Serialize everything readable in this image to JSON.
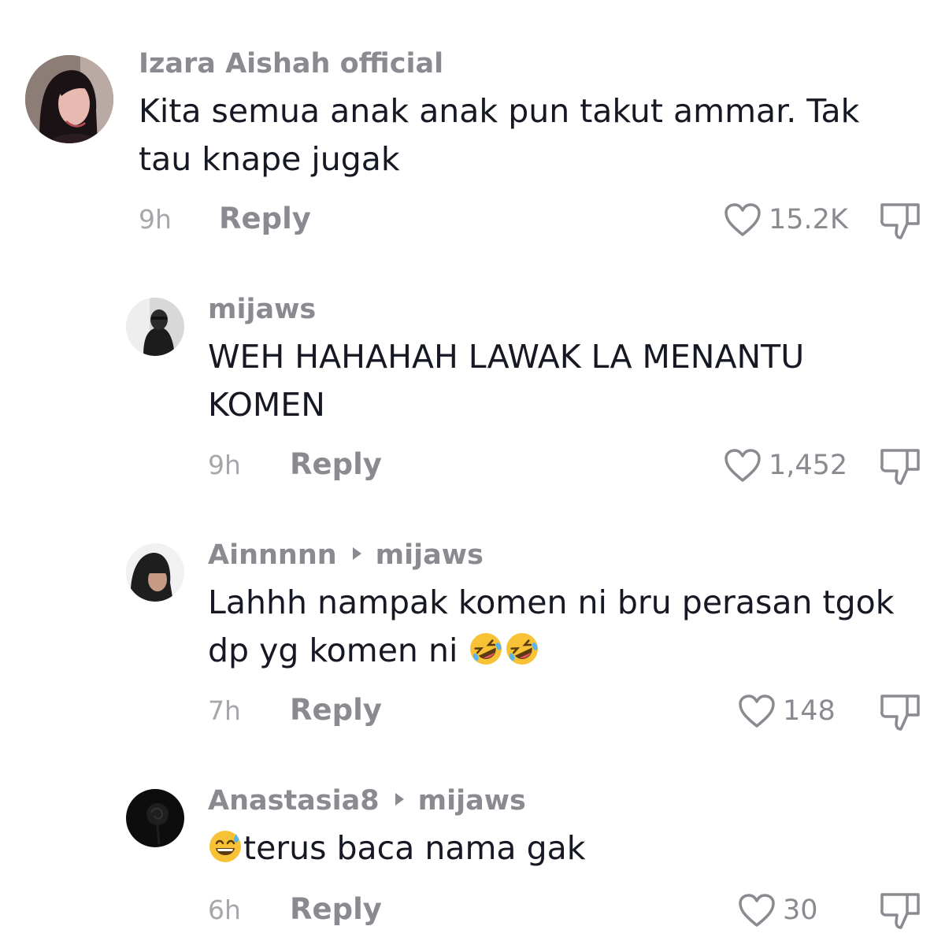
{
  "comments": [
    {
      "username": "Izara Aishah official",
      "reply_to": "",
      "text_line1": "Kita semua anak anak pun takut ammar. Tak",
      "text_line2": "tau knape jugak",
      "time": "9h",
      "reply_label": "Reply",
      "likes": "15.2K",
      "avatar": "woman-portrait"
    },
    {
      "username": "mijaws",
      "reply_to": "",
      "text_line1": "WEH HAHAHAH LAWAK LA MENANTU",
      "text_line2": "KOMEN",
      "time": "9h",
      "reply_label": "Reply",
      "likes": "1,452",
      "avatar": "dark-person"
    },
    {
      "username": "Ainnnnn",
      "reply_to": "mijaws",
      "text_line1": "Lahhh nampak komen ni bru perasan tgok",
      "text_line2": "dp yg komen ni",
      "time": "7h",
      "reply_label": "Reply",
      "likes": "148",
      "avatar": "hijab-woman",
      "emoji": "rolling-on-floor-laughing"
    },
    {
      "username": "Anastasia8",
      "reply_to": "mijaws",
      "text_line1": "terus baca nama gak",
      "time": "6h",
      "reply_label": "Reply",
      "likes": "30",
      "avatar": "dark-rose",
      "emoji": "grinning-face-with-sweat"
    }
  ],
  "colors": {
    "username": "#8a8b91",
    "text": "#161823",
    "time": "#a6a7ab",
    "icon": "#8a8b91"
  }
}
